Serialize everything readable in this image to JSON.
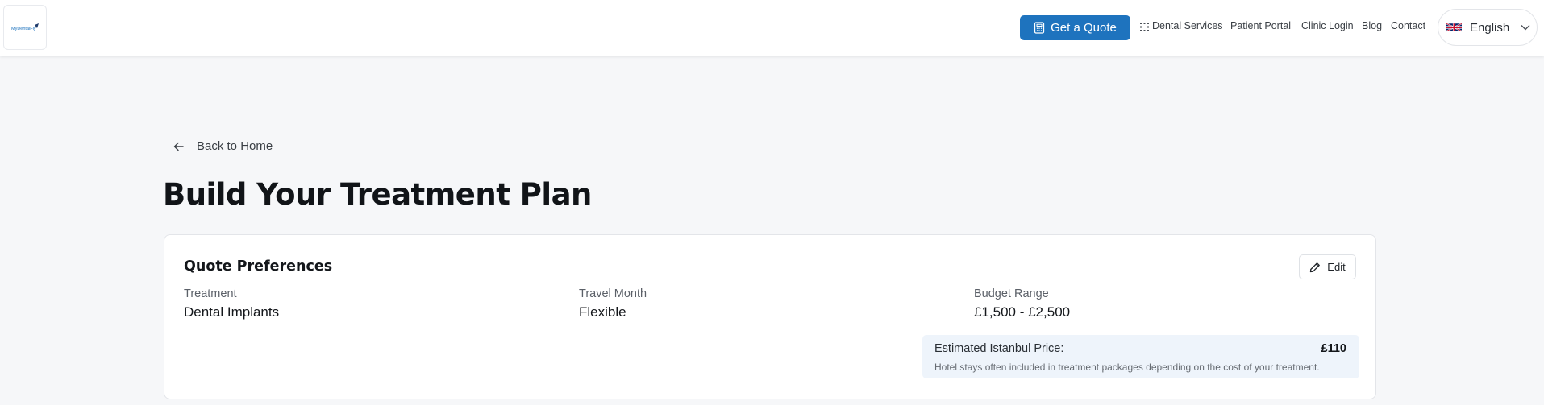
{
  "header": {
    "logo_text": "MyDentalFly",
    "cta_label": "Get a Quote",
    "nav": {
      "dental_services": "Dental Services",
      "patient_portal": "Patient Portal",
      "clinic_login": "Clinic Login",
      "blog": "Blog",
      "contact": "Contact"
    },
    "language": "English",
    "brand_color": "#1e73be"
  },
  "main": {
    "back_label": "Back to Home",
    "title": "Build Your Treatment Plan",
    "card": {
      "title": "Quote Preferences",
      "edit_label": "Edit",
      "fields": [
        {
          "label": "Treatment",
          "value": "Dental Implants"
        },
        {
          "label": "Travel Month",
          "value": "Flexible"
        },
        {
          "label": "Budget Range",
          "value": "£1,500 - £2,500"
        }
      ],
      "estimate": {
        "label": "Estimated Istanbul Price:",
        "value": "£110",
        "note": "Hotel stays often included in treatment packages depending on the cost of your treatment."
      }
    }
  }
}
